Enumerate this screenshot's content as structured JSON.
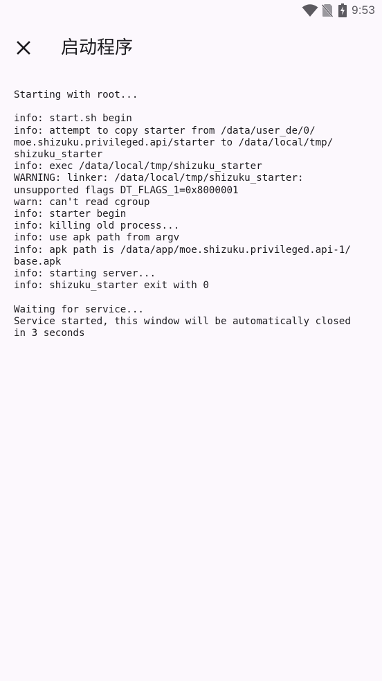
{
  "status_bar": {
    "time": "9:53",
    "icons": [
      "wifi-icon",
      "no-sim-icon",
      "battery-charging-icon"
    ]
  },
  "app_bar": {
    "close_icon": "close-icon",
    "title": "启动程序"
  },
  "log": {
    "lines": [
      "Starting with root...",
      "",
      "info: start.sh begin",
      "info: attempt to copy starter from /data/user_de/0/",
      "moe.shizuku.privileged.api/starter to /data/local/tmp/",
      "shizuku_starter",
      "info: exec /data/local/tmp/shizuku_starter",
      "WARNING: linker: /data/local/tmp/shizuku_starter:",
      "unsupported flags DT_FLAGS_1=0x8000001",
      "warn: can't read cgroup",
      "info: starter begin",
      "info: killing old process...",
      "info: use apk path from argv",
      "info: apk path is /data/app/moe.shizuku.privileged.api-1/",
      "base.apk",
      "info: starting server...",
      "info: shizuku_starter exit with 0",
      "",
      "Waiting for service...",
      "Service started, this window will be automatically closed",
      "in 3 seconds"
    ]
  }
}
